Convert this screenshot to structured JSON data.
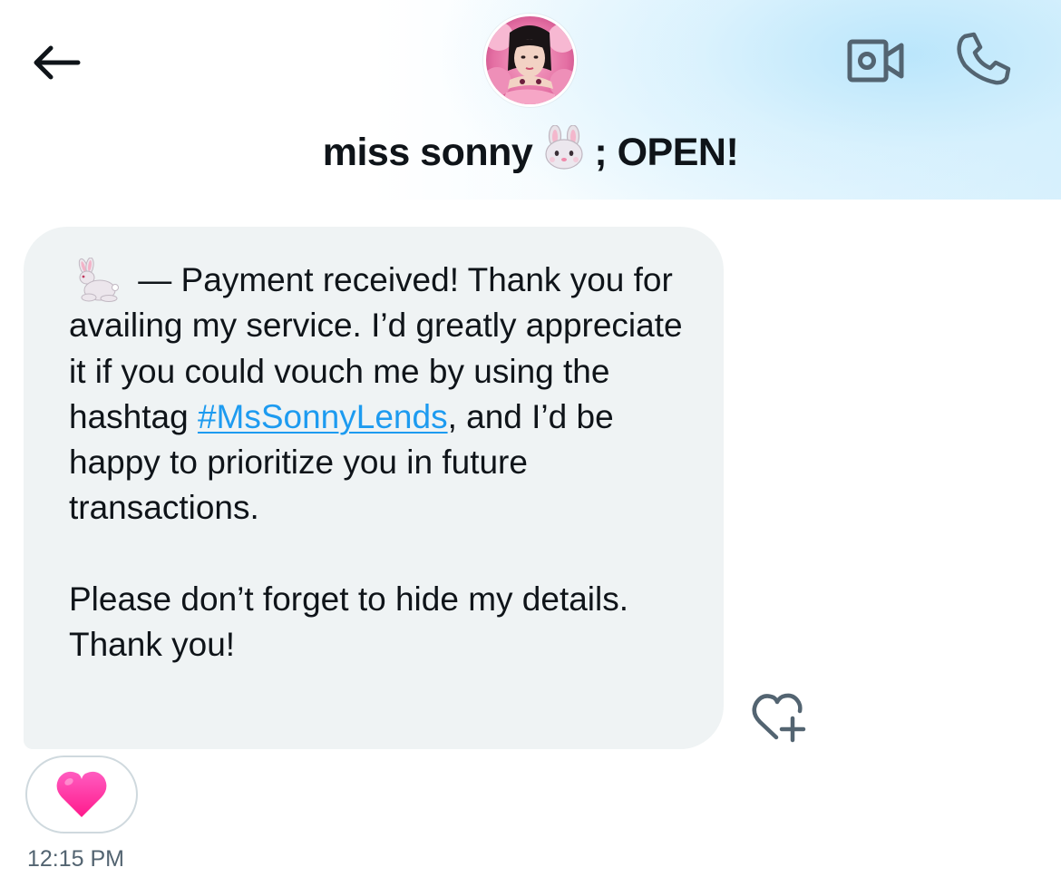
{
  "header": {
    "contact_name": "miss sonny",
    "name_emoji": "rabbit-face-emoji",
    "name_suffix": "; OPEN!",
    "icons": {
      "back": "arrow-left-icon",
      "video": "video-camera-icon",
      "phone": "phone-icon"
    }
  },
  "message": {
    "leading_emoji": "rabbit-emoji",
    "line_intro": " — Payment received! Thank you for availing my service. I’d greatly appreciate it if you could vouch me by using the hashtag ",
    "hashtag": "#MsSonnyLends",
    "line_after_hashtag": ", and I’d be happy to prioritize you in future transactions.",
    "paragraph_2": "Please don’t forget to hide my details. Thank you!",
    "reaction_emoji": "pink-heart-emoji",
    "add_reaction_icon": "heart-plus-icon",
    "timestamp": "12:15 PM"
  },
  "colors": {
    "link": "#1d9bf0",
    "bubble": "#eff3f4",
    "text": "#0f1419",
    "muted": "#536471",
    "icon_gray": "#536471",
    "heart": "#ff2d8f"
  }
}
